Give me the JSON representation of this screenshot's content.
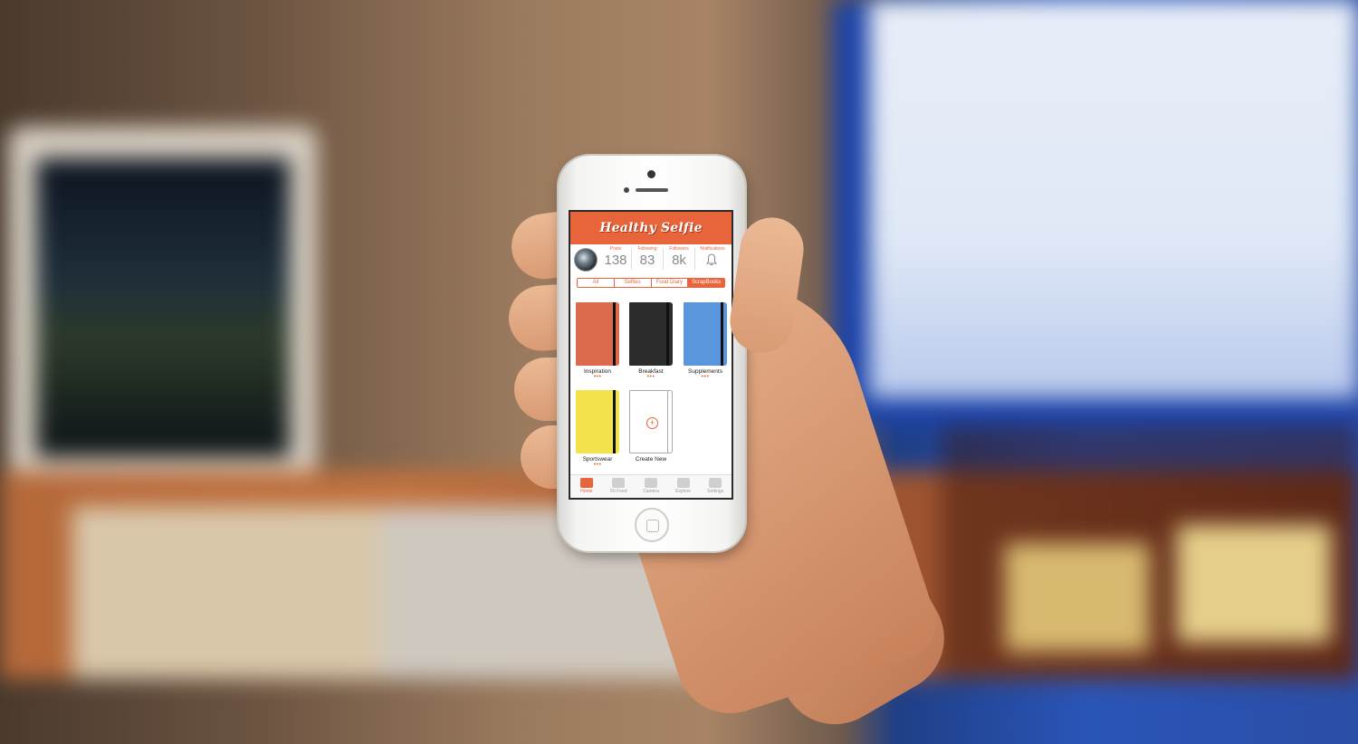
{
  "app": {
    "title": "Healthy Selfie",
    "accent_color": "#e8643b"
  },
  "profile": {
    "stats": [
      {
        "label": "Posts",
        "value": "138"
      },
      {
        "label": "Following",
        "value": "83"
      },
      {
        "label": "Followers",
        "value": "8k"
      },
      {
        "label": "Notifications",
        "icon": "bell-icon"
      }
    ]
  },
  "filter_tabs": [
    {
      "label": "All",
      "active": false
    },
    {
      "label": "Selfies",
      "active": false
    },
    {
      "label": "Food Diary",
      "active": false
    },
    {
      "label": "ScrapBooks",
      "active": true
    }
  ],
  "scrapbooks": [
    {
      "label": "Inspiration",
      "color": "#dc6a4c",
      "more": "•••"
    },
    {
      "label": "Breakfast",
      "color": "#2c2c2c",
      "more": "•••"
    },
    {
      "label": "Supplements",
      "color": "#5a96dc",
      "more": "•••"
    },
    {
      "label": "Sportswear",
      "color": "#f3e34a",
      "more": "•••"
    }
  ],
  "create_new": {
    "label": "Create New",
    "icon": "plus-circle-icon"
  },
  "tabbar": [
    {
      "label": "Home",
      "icon": "home-icon",
      "active": true
    },
    {
      "label": "Fit Feed",
      "icon": "feed-icon",
      "active": false
    },
    {
      "label": "Camera",
      "icon": "camera-icon",
      "active": false
    },
    {
      "label": "Explore",
      "icon": "explore-icon",
      "active": false
    },
    {
      "label": "Settings",
      "icon": "gear-icon",
      "active": false
    }
  ]
}
